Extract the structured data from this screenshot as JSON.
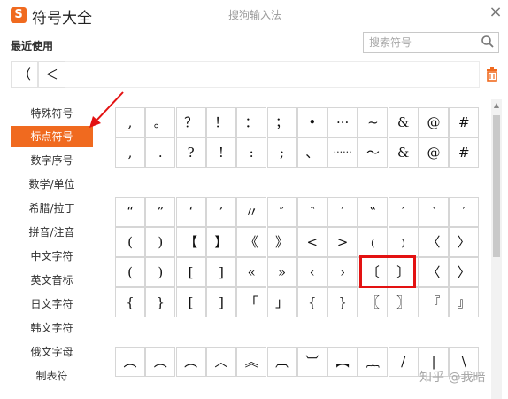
{
  "window": {
    "title": "符号大全",
    "ime_name": "搜狗输入法",
    "logo_letter": "S",
    "close": "×"
  },
  "recent": {
    "label": "最近使用",
    "items": [
      "（",
      "＜"
    ]
  },
  "search": {
    "placeholder": "搜索符号"
  },
  "sidebar": [
    {
      "label": "特殊符号"
    },
    {
      "label": "标点符号",
      "active": true
    },
    {
      "label": "数字序号"
    },
    {
      "label": "数学/单位"
    },
    {
      "label": "希腊/拉丁"
    },
    {
      "label": "拼音/注音"
    },
    {
      "label": "中文字符"
    },
    {
      "label": "英文音标"
    },
    {
      "label": "日文字符"
    },
    {
      "label": "韩文字符"
    },
    {
      "label": "俄文字母"
    },
    {
      "label": "制表符"
    }
  ],
  "groups": [
    {
      "rows": [
        [
          ",",
          "。",
          "？",
          "！",
          "：",
          "；",
          "•",
          "···",
          "~",
          "&",
          "@",
          "#"
        ],
        [
          ",",
          ".",
          "?",
          "!",
          ":",
          ";",
          "、",
          "······",
          "～",
          "&",
          "@",
          "#"
        ]
      ]
    },
    {
      "rows": [
        [
          "“",
          "”",
          "‘",
          "’",
          "〃",
          "″",
          "‶",
          "′",
          "‟",
          "′",
          "‵",
          "′"
        ],
        [
          "(",
          ")",
          "【",
          "】",
          "《",
          "》",
          "<",
          ">",
          "﹙",
          "﹚",
          "〈",
          "〉"
        ],
        [
          "(",
          ")",
          "[",
          "]",
          "«",
          "»",
          "‹",
          "›",
          "〔",
          "〕",
          "〈",
          "〉"
        ],
        [
          "{",
          "}",
          "[",
          "]",
          "「",
          "」",
          "{",
          "}",
          "〖",
          "〗",
          "『",
          "』"
        ]
      ]
    },
    {
      "rows": [
        [
          "︵",
          "︵",
          "︵",
          "︿",
          "︽",
          "︹",
          "︺",
          "︻",
          "︷",
          "/",
          "|",
          "\\"
        ]
      ]
    }
  ],
  "watermark": "知乎 @我暗",
  "accent_color": "#f06a1f",
  "highlight_color": "#e31212"
}
